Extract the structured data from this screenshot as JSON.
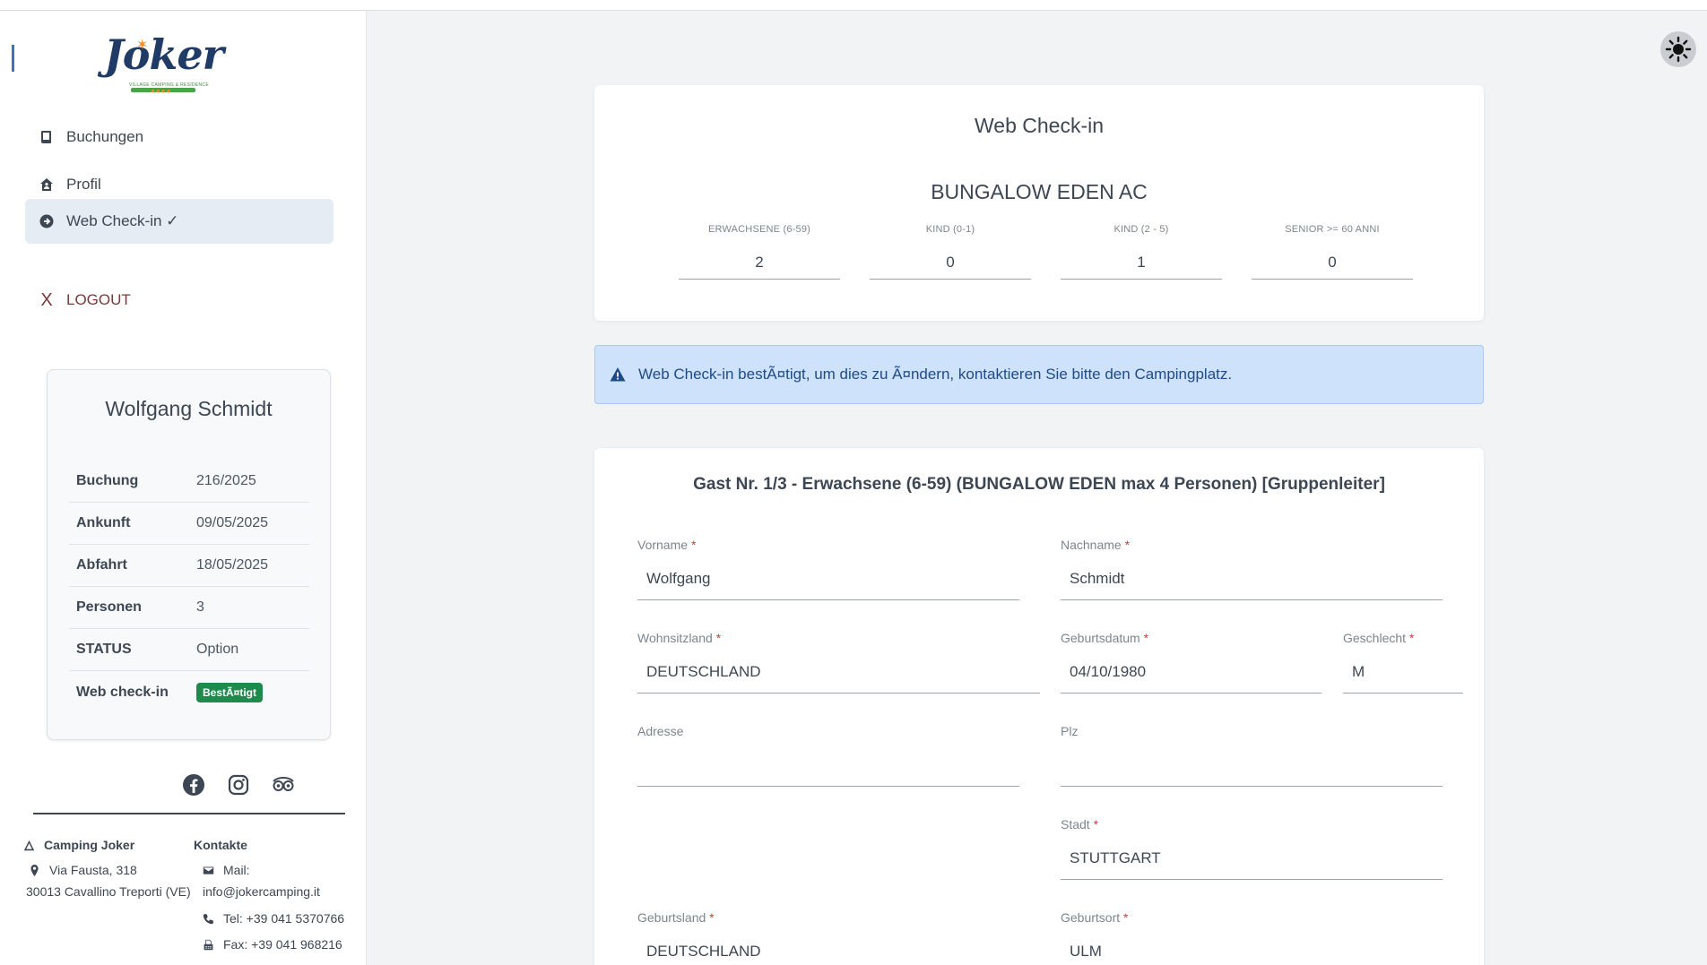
{
  "logo": {
    "word": "Joker",
    "tagline": "VILLAGE CAMPING & RESIDENCE",
    "dots": "●●●●"
  },
  "nav": {
    "bookings": "Buchungen",
    "profile": "Profil",
    "webcheckin": "Web Check-in ✓",
    "logout_x": "X",
    "logout": "LOGOUT"
  },
  "guest": {
    "name": "Wolfgang Schmidt",
    "rows": [
      {
        "k": "Buchung",
        "v": "216/2025"
      },
      {
        "k": "Ankunft",
        "v": "09/05/2025"
      },
      {
        "k": "Abfahrt",
        "v": "18/05/2025"
      },
      {
        "k": "Personen",
        "v": "3"
      },
      {
        "k": "STATUS",
        "v": "Option"
      },
      {
        "k": "Web check-in",
        "v": "BestÃ¤tigt"
      }
    ]
  },
  "footer": {
    "camp_title": "Camping Joker",
    "address1": "Via Fausta, 318",
    "address2": "30013 Cavallino Treporti (VE)",
    "contacts_title": "Kontakte",
    "mail_label": "Mail:",
    "mail": "info@jokercamping.it",
    "tel": "Tel: +39 041 5370766",
    "fax": "Fax: +39 041 968216"
  },
  "checkin": {
    "title": "Web Check-in",
    "unit": "BUNGALOW EDEN AC",
    "counters": [
      {
        "label": "ERWACHSENE (6-59)",
        "value": "2"
      },
      {
        "label": "KIND (0-1)",
        "value": "0"
      },
      {
        "label": "KIND (2 - 5)",
        "value": "1"
      },
      {
        "label": "SENIOR >= 60 ANNI",
        "value": "0"
      }
    ]
  },
  "alert": {
    "text": "Web Check-in bestÃ¤tigt, um dies zu Ã¤ndern, kontaktieren Sie bitte den Campingplatz."
  },
  "form": {
    "title": "Gast Nr. 1/3 - Erwachsene (6-59) (BUNGALOW EDEN max 4 Personen) [Gruppenleiter]",
    "required_mark": "*",
    "vorname_label": "Vorname",
    "vorname": "Wolfgang",
    "nachname_label": "Nachname",
    "nachname": "Schmidt",
    "wohnsitzland_label": "Wohnsitzland",
    "wohnsitzland": "DEUTSCHLAND",
    "geburtsdatum_label": "Geburtsdatum",
    "geburtsdatum": "04/10/1980",
    "geschlecht_label": "Geschlecht",
    "geschlecht": "M",
    "adresse_label": "Adresse",
    "adresse": "",
    "plz_label": "Plz",
    "plz": "",
    "stadt_label": "Stadt",
    "stadt": "STUTTGART",
    "geburtsland_label": "Geburtsland",
    "geburtsland": "DEUTSCHLAND",
    "geburtsort_label": "Geburtsort",
    "geburtsort": "ULM"
  },
  "colors": {
    "accent": "#3a71c9",
    "badge": "#1e8b4c",
    "alert_bg": "#cfe2fc",
    "alert_text": "#1d4a8a"
  }
}
